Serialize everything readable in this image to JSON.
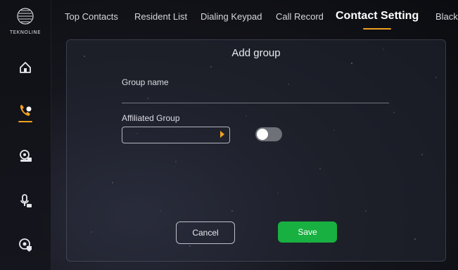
{
  "brand": {
    "name": "TEKNOLINE"
  },
  "sidebar": {
    "items": [
      {
        "icon": "home-icon",
        "active": false
      },
      {
        "icon": "phone-icon",
        "active": true
      },
      {
        "icon": "camera-icon",
        "active": false
      },
      {
        "icon": "mic-icon",
        "active": false
      },
      {
        "icon": "settings-shield-icon",
        "active": false
      }
    ]
  },
  "tabs": [
    {
      "label": "Top Contacts"
    },
    {
      "label": "Resident List"
    },
    {
      "label": "Dialing Keypad"
    },
    {
      "label": "Call Record"
    },
    {
      "label": "Contact Setting",
      "active": true
    },
    {
      "label": "Black"
    }
  ],
  "dialog": {
    "title": "Add group",
    "group_name_label": "Group name",
    "group_name_value": "",
    "affiliated_label": "Affiliated Group",
    "affiliated_value": "",
    "toggle_on": false,
    "cancel_label": "Cancel",
    "save_label": "Save"
  },
  "colors": {
    "accent": "#f0a020",
    "save": "#18b040",
    "toggle_off": "#6e7178"
  }
}
